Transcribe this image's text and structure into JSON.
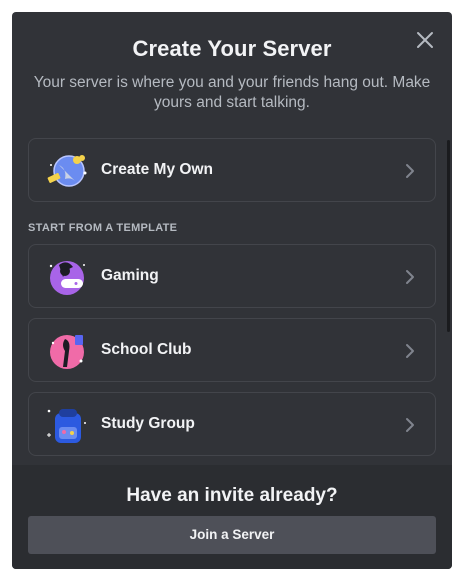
{
  "modal": {
    "title": "Create Your Server",
    "subtitle": "Your server is where you and your friends hang out. Make yours and start talking.",
    "close_icon": "close-icon"
  },
  "options": {
    "create": {
      "label": "Create My Own",
      "icon": "globe-create-icon"
    },
    "section_label": "START FROM A TEMPLATE",
    "templates": [
      {
        "label": "Gaming",
        "icon": "gaming-icon"
      },
      {
        "label": "School Club",
        "icon": "school-club-icon"
      },
      {
        "label": "Study Group",
        "icon": "study-group-icon"
      }
    ]
  },
  "footer": {
    "title": "Have an invite already?",
    "join_label": "Join a Server"
  },
  "colors": {
    "modal_bg": "#313338",
    "footer_bg": "#2b2d31",
    "button_bg": "#4e5058",
    "text_primary": "#f2f3f5",
    "text_secondary": "#b5bac1"
  }
}
